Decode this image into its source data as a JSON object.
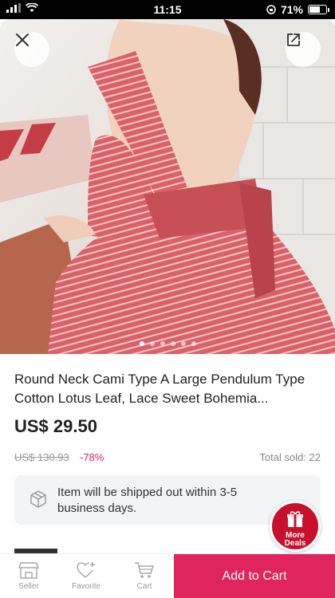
{
  "status_bar": {
    "time": "11:15",
    "battery": "71%",
    "battery_level": 0.71
  },
  "gallery": {
    "image_count": 6,
    "active_index": 0
  },
  "product": {
    "title": "Round Neck Cami Type A Large Pendulum Type Cotton Lotus Leaf, Lace Sweet Bohemia...",
    "price": "US$ 29.50",
    "original_price": "US$ 130.93",
    "discount": "-78%",
    "total_sold": "Total sold: 22"
  },
  "shipping": {
    "message": "Item will be shipped out within 3-5 business days."
  },
  "more_deals": {
    "label": "More\nDeals"
  },
  "bottom_nav": {
    "seller": "Seller",
    "favorite": "Favorite",
    "cart": "Cart",
    "add_to_cart": "Add to Cart"
  },
  "colors": {
    "accent": "#e0245e",
    "deals_badge": "#c8102e"
  }
}
